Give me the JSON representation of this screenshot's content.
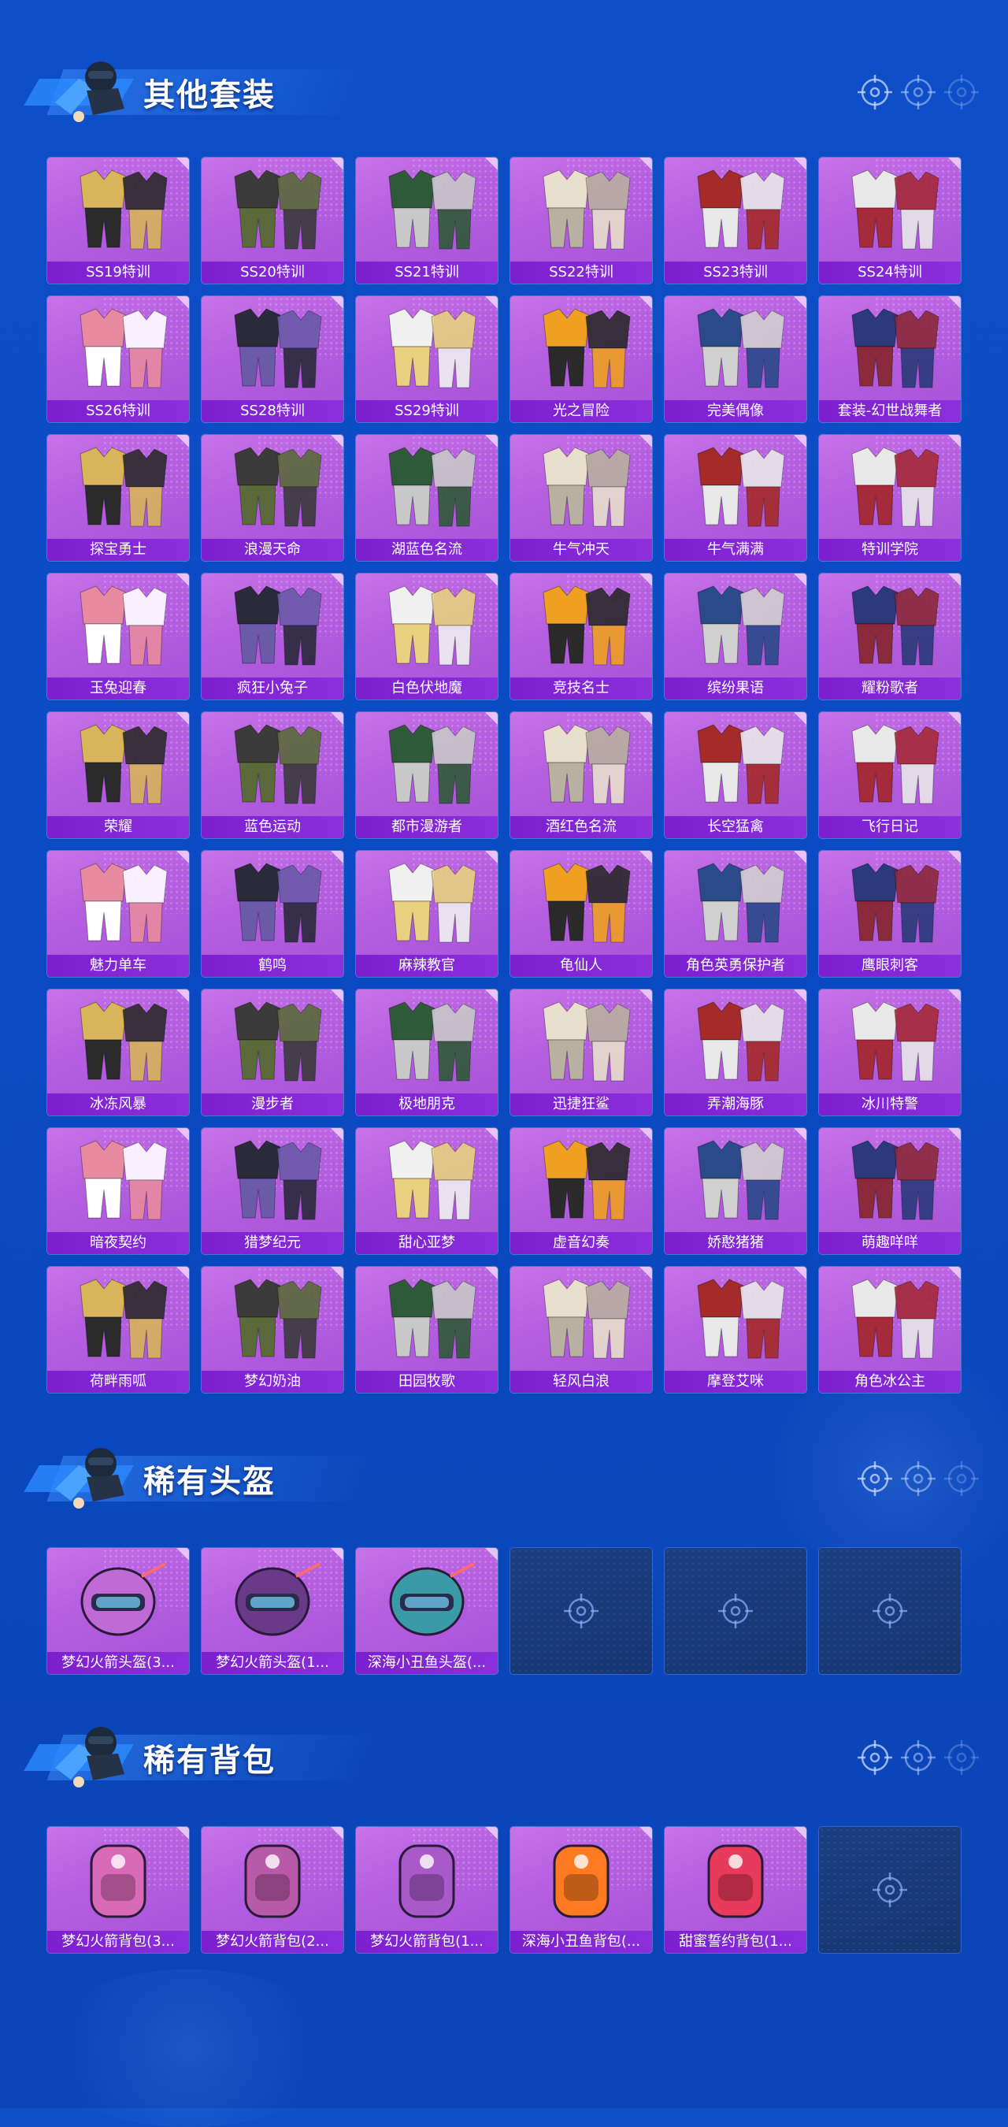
{
  "sections": {
    "suits": {
      "title": "其他套装",
      "items": [
        "SS19特训",
        "SS20特训",
        "SS21特训",
        "SS22特训",
        "SS23特训",
        "SS24特训",
        "SS26特训",
        "SS28特训",
        "SS29特训",
        "光之冒险",
        "完美偶像",
        "套装-幻世战舞者",
        "探宝勇士",
        "浪漫天命",
        "湖蓝色名流",
        "牛气冲天",
        "牛气满满",
        "特训学院",
        "玉兔迎春",
        "疯狂小兔子",
        "白色伏地魔",
        "竞技名士",
        "缤纷果语",
        "耀粉歌者",
        "荣耀",
        "蓝色运动",
        "都市漫游者",
        "酒红色名流",
        "长空猛禽",
        "飞行日记",
        "魅力单车",
        "鹤鸣",
        "麻辣教官",
        "龟仙人",
        "角色英勇保护者",
        "鹰眼刺客",
        "冰冻风暴",
        "漫步者",
        "极地朋克",
        "迅捷狂鲨",
        "弄潮海豚",
        "冰川特警",
        "暗夜契约",
        "猎梦纪元",
        "甜心亚梦",
        "虚音幻奏",
        "娇憨猪猪",
        "萌趣咩咩",
        "荷畔雨呱",
        "梦幻奶油",
        "田园牧歌",
        "轻风白浪",
        "摩登艾咪",
        "角色冰公主"
      ]
    },
    "helmets": {
      "title": "稀有头盔",
      "items": [
        "梦幻火箭头盔(3...",
        "梦幻火箭头盔(1...",
        "深海小丑鱼头盔(..."
      ],
      "empty_slots": 3
    },
    "backpacks": {
      "title": "稀有背包",
      "items": [
        "梦幻火箭背包(3...",
        "梦幻火箭背包(2...",
        "梦幻火箭背包(1...",
        "深海小丑鱼背包(...",
        "甜蜜誓约背包(1..."
      ],
      "empty_slots": 1
    }
  },
  "icons": {
    "header_mascot": "soldier-mascot-icon",
    "header_decor": "crosshair-icon",
    "empty_slot": "crosshair-icon"
  },
  "colors": {
    "background": "#0b4bc4",
    "card": "#b55fe0",
    "label_bar": "#7b1fcf",
    "empty_card": "#1c3f82"
  }
}
